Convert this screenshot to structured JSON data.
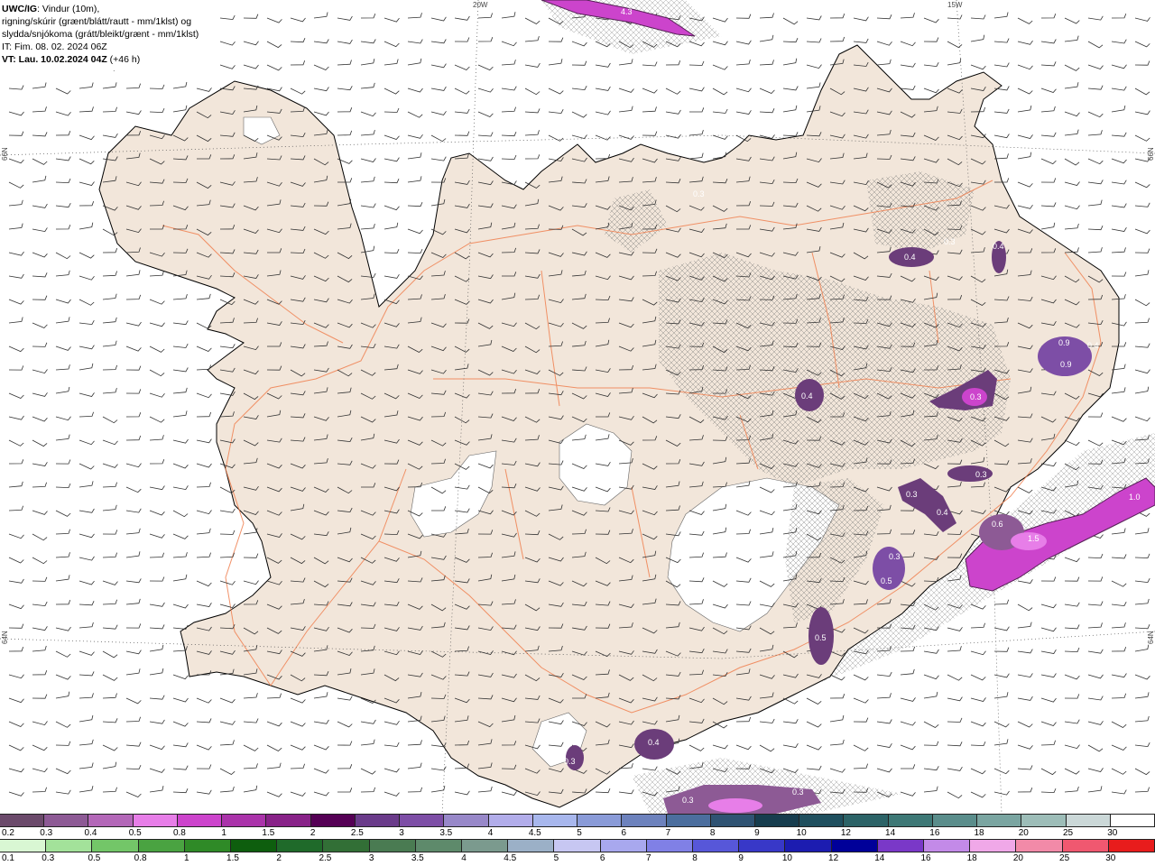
{
  "header": {
    "line1_bold": "UWC/IG",
    "line1_rest": ": Vindur (10m),",
    "line2": "rigning/skúrir (grænt/blátt/rautt - mm/1klst) og",
    "line3": "slydda/snjókoma (grátt/bleikt/grænt - mm/1klst)",
    "line4": "IT: Fim. 08. 02. 2024 06Z",
    "line5_bold": "VT: Lau. 10.02.2024 04Z",
    "line5_rest": " (+46 h)"
  },
  "coords": {
    "w20": "20W",
    "w15": "15W",
    "n66_left": "66N",
    "n66_right": "66N",
    "n64_left": "64N",
    "n64_right": "64N"
  },
  "precip_labels": [
    "4.3",
    "0.4",
    "0.4",
    "0.3",
    "0.4",
    "0.9",
    "0.9",
    "0.4",
    "0.3",
    "0.3",
    "0.3",
    "0.4",
    "0.3",
    "0.6",
    "1.5",
    "1.0",
    "0.5",
    "0.5",
    "0.4",
    "0.3",
    "0.3",
    "0.3",
    "0.3"
  ],
  "snow_scale": {
    "labels": [
      "0.2",
      "0.3",
      "0.4",
      "0.5",
      "0.8",
      "1",
      "1.5",
      "2",
      "2.5",
      "3",
      "3.5",
      "4",
      "4.5",
      "5",
      "6",
      "7",
      "8",
      "9",
      "10",
      "12",
      "14",
      "16",
      "18",
      "20",
      "25",
      "30"
    ],
    "colors": [
      "#6b4a6b",
      "#8d5a95",
      "#b367b8",
      "#e77ee8",
      "#cc44cc",
      "#aa33aa",
      "#882288",
      "#550055",
      "#6a3b8a",
      "#7d4ea6",
      "#9888c9",
      "#b2adea",
      "#a8b7ed",
      "#8a9bd8",
      "#6d82bd",
      "#4b6e9e",
      "#2f5373",
      "#173d4e",
      "#1f4f5e",
      "#2c6367",
      "#3e7876",
      "#5a8d8b",
      "#7aa5a1",
      "#9dbdb8",
      "#cbd8d8",
      "#ffffff"
    ]
  },
  "rain_scale": {
    "labels": [
      "0.1",
      "0.3",
      "0.5",
      "0.8",
      "1",
      "1.5",
      "2",
      "2.5",
      "3",
      "3.5",
      "4",
      "4.5",
      "5",
      "6",
      "7",
      "8",
      "9",
      "10",
      "12",
      "14",
      "16",
      "18",
      "20",
      "25",
      "30"
    ],
    "colors": [
      "#d9f7d3",
      "#a3e29a",
      "#73c668",
      "#4aa341",
      "#2f8a27",
      "#0e5e0e",
      "#1f6a2a",
      "#326f36",
      "#4a7b52",
      "#5e8a6b",
      "#7b9a8e",
      "#9bb0c7",
      "#c7c7f2",
      "#a8a8ee",
      "#8080e6",
      "#5757d9",
      "#3838c8",
      "#1c1cb0",
      "#000099",
      "#7a38c8",
      "#c38ae8",
      "#f0a8e8",
      "#f28aa8",
      "#f05870",
      "#e81c1c"
    ]
  }
}
